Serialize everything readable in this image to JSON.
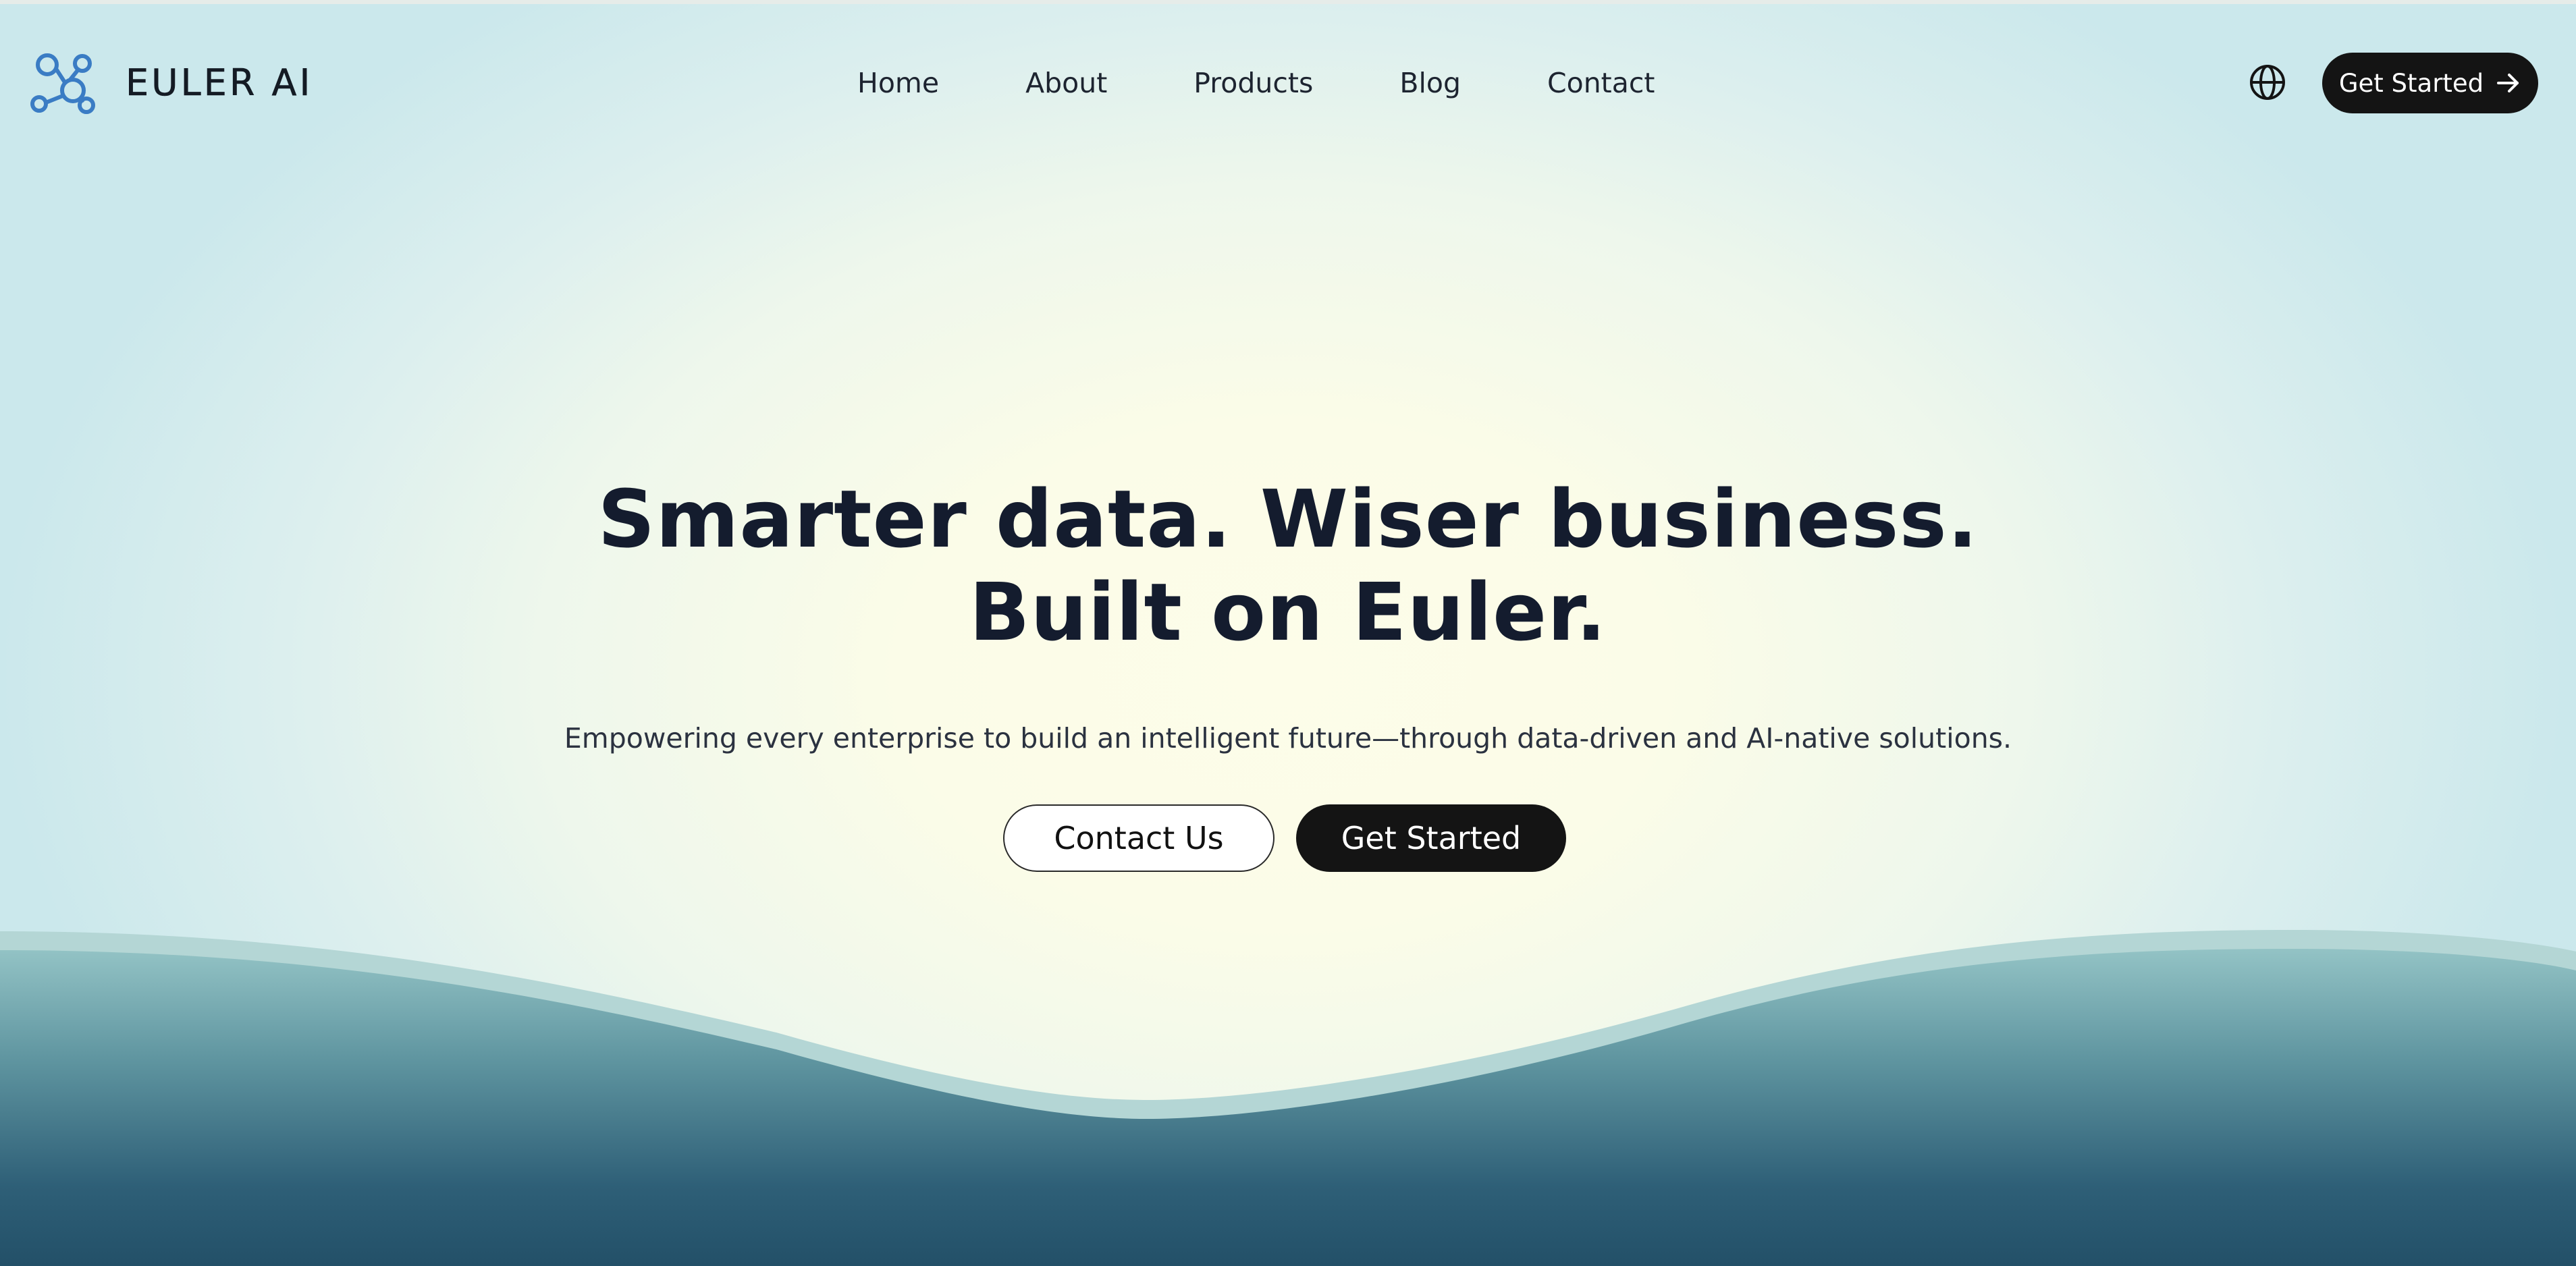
{
  "brand": {
    "logo_icon": "network-nodes-icon",
    "name": "EULER AI"
  },
  "nav": {
    "items": [
      "Home",
      "About",
      "Products",
      "Blog",
      "Contact"
    ]
  },
  "header": {
    "language_icon": "globe-icon",
    "cta_label": "Get Started",
    "cta_icon": "arrow-right-icon"
  },
  "hero": {
    "title_line1": "Smarter data. Wiser business.",
    "title_line2": "Built on Euler.",
    "subtitle": "Empowering every enterprise to build an intelligent future—through data-driven and AI-native solutions.",
    "contact_label": "Contact Us",
    "start_label": "Get Started"
  },
  "colors": {
    "accent_logo": "#3a7cc4",
    "button_dark": "#141414",
    "heading": "#141c2e",
    "wave_top": "#93c3c5",
    "wave_bottom": "#235068"
  }
}
